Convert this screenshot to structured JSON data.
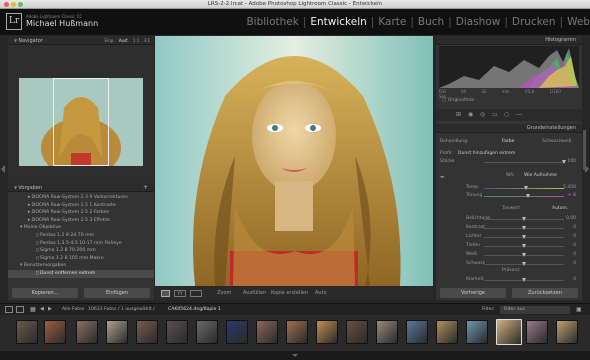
{
  "window": {
    "title": "LRS-2-2.lrcat - Adobe Photoshop Lightroom Classic - Entwickeln"
  },
  "identity": {
    "logo": "Lr",
    "brand": "Adobe Lightroom Classic CC",
    "user": "Michael Hußmann"
  },
  "modules": [
    "Bibliothek",
    "Entwickeln",
    "Karte",
    "Buch",
    "Diashow",
    "Drucken",
    "Web"
  ],
  "navigator": {
    "title": "Navigator",
    "zooms": [
      "Einp.",
      "Ausf.",
      "1:1",
      "3:1"
    ]
  },
  "presets": {
    "title": "Vorgaben",
    "items": [
      {
        "label": "DOCMA Raw-System 2.3 9 Vorkorrekturen",
        "indent": 2,
        "arrow": "▸"
      },
      {
        "label": "DOCMA Raw-System 2.5 1 Kontraste",
        "indent": 2,
        "arrow": "▸"
      },
      {
        "label": "DOCMA Raw-System 2.5 2 Farben",
        "indent": 2,
        "arrow": "▸"
      },
      {
        "label": "DOCMA Raw-System 2.5 3 Effekte",
        "indent": 2,
        "arrow": "▸"
      },
      {
        "label": "Meine Objektive",
        "indent": 1,
        "arrow": "▾"
      },
      {
        "label": "Pentax 1.2 8-24 70 mm",
        "indent": 3,
        "arrow": "▯"
      },
      {
        "label": "Pentax 1.3.5-4.5 10-17 mm Fisheye",
        "indent": 3,
        "arrow": "▯"
      },
      {
        "label": "Sigma 1.2 8 70-200 mm",
        "indent": 3,
        "arrow": "▯"
      },
      {
        "label": "Sigma 1.2 8 105 mm Makro",
        "indent": 3,
        "arrow": "▯"
      },
      {
        "label": "Benutzervorgaben",
        "indent": 1,
        "arrow": "▾"
      },
      {
        "label": "Dunst entfernen extrem",
        "indent": 3,
        "arrow": "▯"
      }
    ]
  },
  "left_buttons": {
    "copy": "Kopieren...",
    "paste": "Einfügen"
  },
  "toolbar": {
    "zoom": "Zoom",
    "zoom_value": "Ausfüllen",
    "soft_proof": "Kopie erstellen",
    "auto": "Auto"
  },
  "histogram": {
    "title": "Histogramm",
    "info": [
      "ISO 64",
      "32 mm",
      "f/5.6",
      "1/160 Sek."
    ],
    "original": "Originalfoto"
  },
  "basic": {
    "title": "Grundeinstellungen",
    "treatment_label": "Behandlung:",
    "treatment_color": "Farbe",
    "treatment_bw": "Schwarzweiß",
    "profile_label": "Profil:",
    "profile_value": "Dunst hinzufügen extrem",
    "amount_label": "Stärke",
    "amount_value": "100",
    "wb_label": "WA:",
    "wb_value": "Wie Aufnahme",
    "temp_label": "Temp.",
    "temp_value": "5.450",
    "tint_label": "Tönung",
    "tint_value": "+ 8",
    "tone_label": "Tonwert",
    "tone_auto": "Autom.",
    "sliders": [
      {
        "label": "Belichtung",
        "value": "0,00",
        "pos": 0.5
      },
      {
        "label": "Kontrast",
        "value": "0",
        "pos": 0.5
      },
      {
        "label": "Lichter",
        "value": "0",
        "pos": 0.5
      },
      {
        "label": "Tiefen",
        "value": "0",
        "pos": 0.5
      },
      {
        "label": "Weiß",
        "value": "0",
        "pos": 0.5
      },
      {
        "label": "Schwarz",
        "value": "0",
        "pos": 0.5
      }
    ],
    "presence_label": "Präsenz",
    "clarity_label": "Klarheit",
    "clarity_value": "0"
  },
  "right_buttons": {
    "prev": "Vorherige",
    "reset": "Zurücksetzen"
  },
  "filmstrip": {
    "source_label": "Alle Fotos",
    "info": "10633 Fotos / 1 ausgewählt /",
    "filename": "CAK05624.dng/Kopie 1",
    "filter_label": "Filter:",
    "filter_value": "Filter aus"
  }
}
